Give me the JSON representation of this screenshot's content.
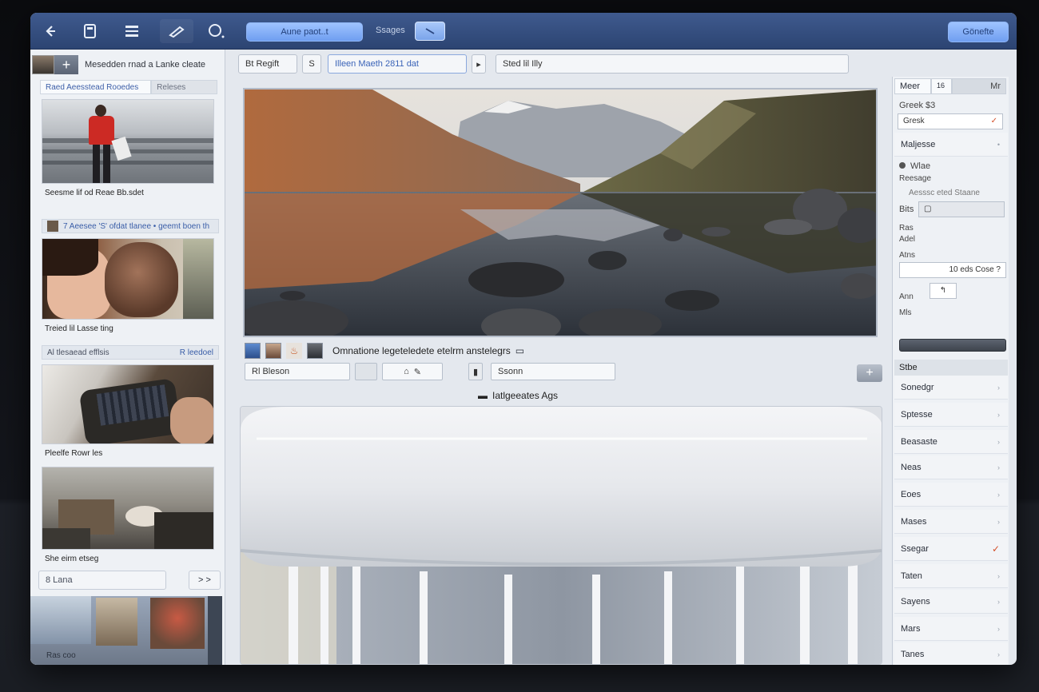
{
  "toolbar": {
    "primary_button": "Aune paot..t",
    "label": "Ssages",
    "right_button": "Gönefte"
  },
  "sidebar": {
    "title": "Mesedden rnad a Lanke cleate",
    "tabs": [
      "Raed Aeesstead Rooedes",
      "Releses"
    ],
    "cards": [
      {
        "caption": "Seesme lif od Reae Bb.sdet"
      },
      {
        "caption": "Treied lil Lasse ting"
      },
      {
        "caption": "Pleelfe Rowr les"
      },
      {
        "caption": "She eirm etseg"
      }
    ],
    "row_1": "7  Aeesee 'S' ofdat tlanee • geemt boen  th",
    "row_2_left": "Al tlesaead efflsis",
    "row_2_right": "R  leedoel",
    "search_value": "8 Lana",
    "next_label": "> >",
    "bottom_label": "Ras          coo"
  },
  "center": {
    "path_1": "Bt Regift",
    "path_2": "S",
    "path_3": "Illeen      Maeth 2811 dat",
    "path_4": "Sted lil      Illy",
    "strip_text": "Omnatione legeteledete etelrm anstelegrs",
    "field_1": "Rl Bleson",
    "field_2": "Rl Bleson",
    "field_3": "Ssonn",
    "section_label": "Iatlgeeates Ags"
  },
  "right_panel": {
    "tabs": [
      "Meer",
      "16",
      "Mr"
    ],
    "label_1": "Greek $3",
    "field_greek": "Gresk",
    "rows_top": [
      "Maljesse"
    ],
    "bullet_label": "Wlae",
    "small_1": "Reesage",
    "small_2": "Aesssc eted Staane",
    "bits_label": "Bits",
    "small_3": "Ras",
    "small_4": "Adel",
    "small_5": "Atns",
    "field_case": "10 eds Cose  ?",
    "small_6": "Ann",
    "small_7": "Mls",
    "section": "Stbe",
    "rows": [
      "Sonedgr",
      "Sptesse",
      "Beasaste",
      "Neas",
      "Eoes",
      "Mases",
      "Ssegar",
      "Taten",
      "Sayens",
      "Mars",
      "Tanes"
    ]
  },
  "colors": {
    "toolbar": "#3f5a8e",
    "accent": "#7aa4ea",
    "panel": "#eef1f5"
  }
}
